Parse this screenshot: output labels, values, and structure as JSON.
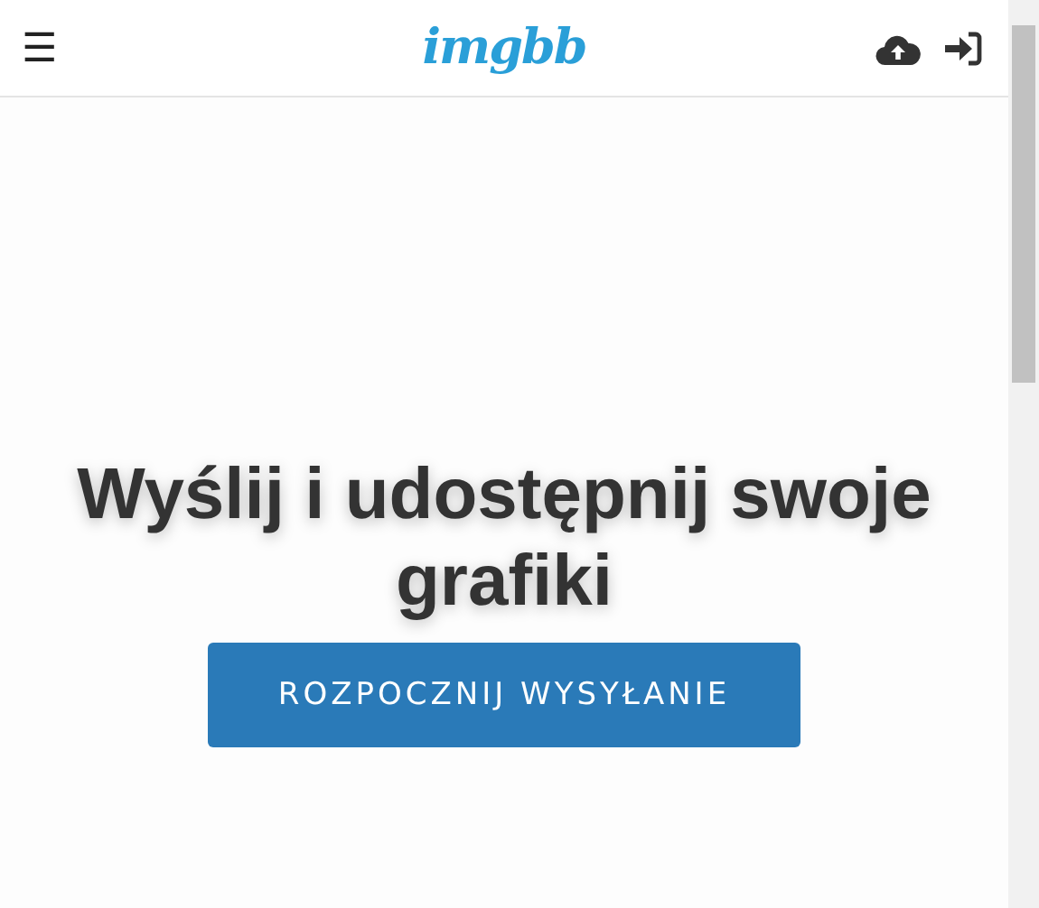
{
  "header": {
    "menu_icon": "☰",
    "logo": "imgbb"
  },
  "hero": {
    "title": "Wyślij i udostępnij swoje grafiki",
    "button": "ROZPOCZNIJ WYSYŁANIE"
  }
}
